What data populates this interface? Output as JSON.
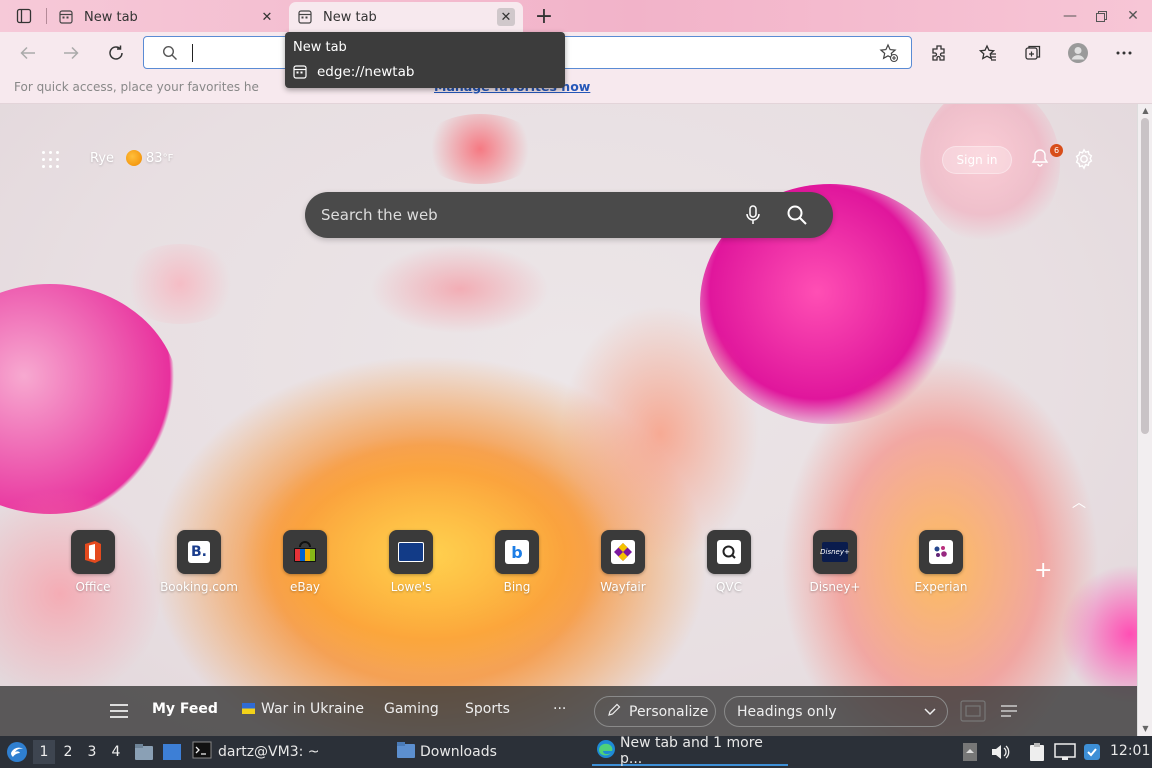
{
  "browser": {
    "tabs": [
      {
        "title": "New tab",
        "active": false
      },
      {
        "title": "New tab",
        "active": true
      }
    ],
    "address_value": "",
    "tooltip": {
      "title": "New tab",
      "url": "edge://newtab"
    },
    "favorites_bar": {
      "message": "For quick access, place your favorites he",
      "link": "Manage favorites now"
    }
  },
  "newtab": {
    "location": "Rye",
    "temperature": "83",
    "temp_unit": "°F",
    "sign_in": "Sign in",
    "notification_count": "6",
    "search_placeholder": "Search the web",
    "quick_links": [
      {
        "label": "Office",
        "icon": "office-icon"
      },
      {
        "label": "Booking.com",
        "icon": "booking-icon"
      },
      {
        "label": "eBay",
        "icon": "ebay-icon"
      },
      {
        "label": "Lowe's",
        "icon": "lowes-icon"
      },
      {
        "label": "Bing",
        "icon": "bing-icon"
      },
      {
        "label": "Wayfair",
        "icon": "wayfair-icon"
      },
      {
        "label": "QVC",
        "icon": "qvc-icon"
      },
      {
        "label": "Disney+",
        "icon": "disney-icon"
      },
      {
        "label": "Experian",
        "icon": "experian-icon"
      }
    ],
    "feed": {
      "items": [
        "My Feed",
        "War in Ukraine",
        "Gaming",
        "Sports",
        "···"
      ],
      "personalize": "Personalize",
      "view_mode": "Headings only"
    }
  },
  "taskbar": {
    "workspaces": [
      "1",
      "2",
      "3",
      "4"
    ],
    "tasks": [
      {
        "label": "dartz@VM3: ~",
        "icon": "terminal-icon"
      },
      {
        "label": "Downloads",
        "icon": "folder-icon"
      },
      {
        "label": "New tab and 1 more p...",
        "icon": "edge-icon"
      }
    ],
    "clock": "12:01"
  },
  "colors": {
    "tab_strip": "#f2b3c9",
    "toolbar": "#f7e9ee",
    "omnibox_border": "#5a8bd4",
    "feed_bar": "#3c3c3c",
    "taskbar": "#2b3038"
  }
}
